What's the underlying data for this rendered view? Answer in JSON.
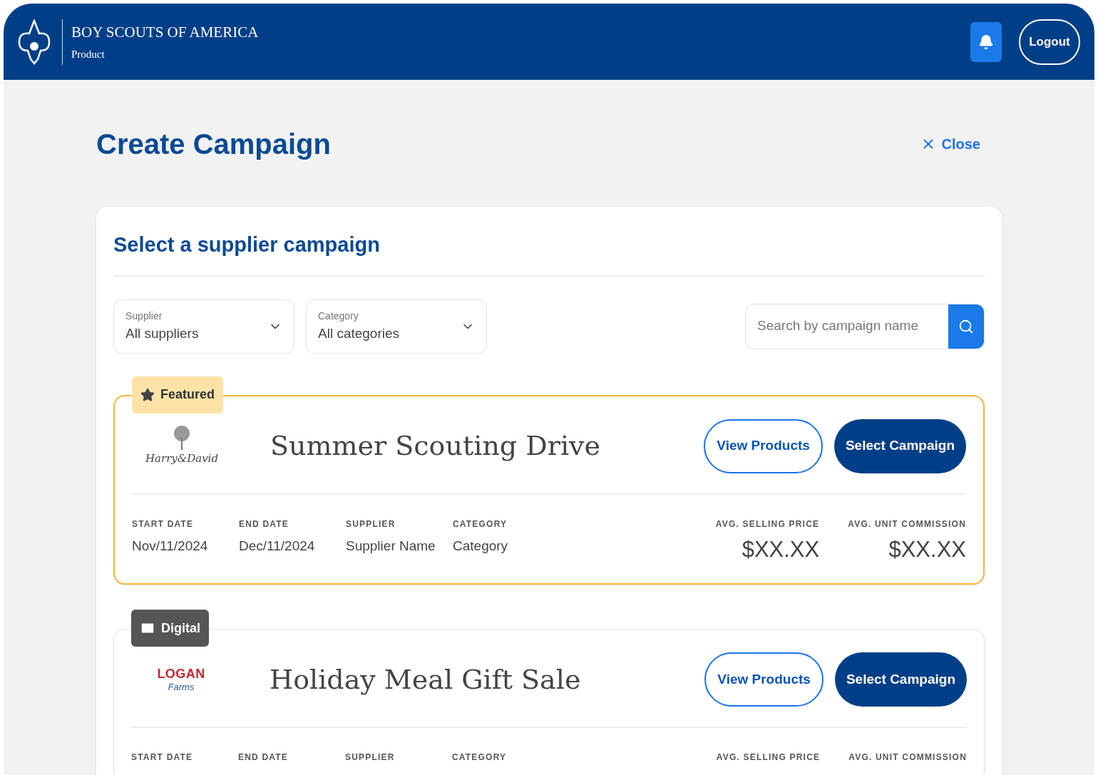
{
  "header": {
    "brand": "BOY SCOUTS OF AMERICA",
    "product": "Product",
    "logout": "Logout"
  },
  "page": {
    "title": "Create Campaign",
    "close": "Close"
  },
  "panel": {
    "title": "Select a supplier campaign",
    "filters": [
      {
        "label": "Supplier",
        "value": "All suppliers"
      },
      {
        "label": "Category",
        "value": "All categories"
      }
    ],
    "search": {
      "placeholder": "Search by campaign name"
    }
  },
  "campaigns": [
    {
      "kind": "featured",
      "badge": "Featured",
      "logo": [
        "Harry&David"
      ],
      "name": "Summer Scouting Drive",
      "view": "View Products",
      "select": "Select Campaign",
      "fields": [
        {
          "label": "START DATE",
          "value": "Nov/11/2024"
        },
        {
          "label": "END DATE",
          "value": "Dec/11/2024"
        },
        {
          "label": "SUPPLIER",
          "value": "Supplier Name"
        },
        {
          "label": "CATEGORY",
          "value": "Category"
        }
      ],
      "prices": [
        {
          "label": "AVG. SELLING PRICE",
          "value": "$XX.XX"
        },
        {
          "label": "AVG. UNIT COMMISSION",
          "value": "$XX.XX"
        }
      ]
    },
    {
      "kind": "digital",
      "badge": "Digital",
      "logo": [
        "LOGAN",
        "Farms"
      ],
      "name": "Holiday Meal Gift Sale",
      "view": "View Products",
      "select": "Select Campaign",
      "fields": [
        {
          "label": "START DATE"
        },
        {
          "label": "END DATE"
        },
        {
          "label": "SUPPLIER"
        },
        {
          "label": "CATEGORY"
        }
      ],
      "prices": [
        {
          "label": "AVG. SELLING PRICE"
        },
        {
          "label": "AVG. UNIT COMMISSION"
        }
      ]
    }
  ]
}
